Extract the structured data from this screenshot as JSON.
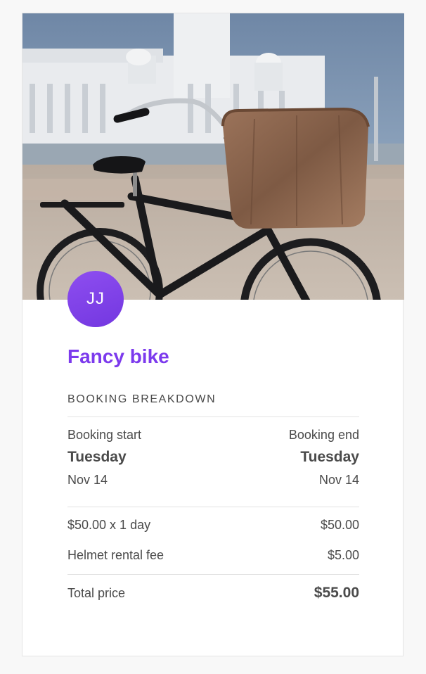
{
  "listing": {
    "avatar_initials": "JJ",
    "title": "Fancy bike"
  },
  "breakdown": {
    "heading": "BOOKING BREAKDOWN",
    "start_label": "Booking start",
    "end_label": "Booking end",
    "start_day": "Tuesday",
    "end_day": "Tuesday",
    "start_date": "Nov 14",
    "end_date": "Nov 14",
    "line_items": [
      {
        "label": "$50.00 x 1 day",
        "amount": "$50.00"
      },
      {
        "label": "Helmet rental fee",
        "amount": "$5.00"
      }
    ],
    "total_label": "Total price",
    "total_amount": "$55.00"
  },
  "colors": {
    "accent": "#7c3aed",
    "avatar_bg": "#8b46ee",
    "text": "#4a4a4a",
    "divider": "#e2e2e2"
  },
  "icons": {
    "hero": "bicycle-photo"
  }
}
